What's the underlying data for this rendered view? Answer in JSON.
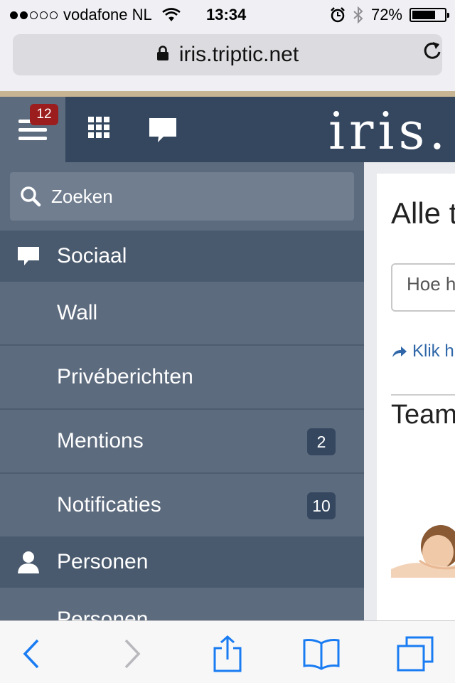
{
  "status_bar": {
    "carrier": "vodafone NL",
    "time": "13:34",
    "battery": "72%",
    "battery_level": 0.72,
    "signal_dots_filled": 2,
    "signal_dots_total": 5
  },
  "browser": {
    "url": "iris.triptic.net"
  },
  "app_header": {
    "menu_badge": "12",
    "logo": "iris."
  },
  "sidebar": {
    "search_placeholder": "Zoeken",
    "sections": [
      {
        "label": "Sociaal",
        "icon": "chat-icon",
        "items": [
          {
            "label": "Wall",
            "count": ""
          },
          {
            "label": "Privéberichten",
            "count": ""
          },
          {
            "label": "Mentions",
            "count": "2"
          },
          {
            "label": "Notificaties",
            "count": "10"
          }
        ]
      },
      {
        "label": "Personen",
        "icon": "person-icon",
        "items": [
          {
            "label": "Personen",
            "count": ""
          }
        ]
      }
    ]
  },
  "content": {
    "heading": "Alle t",
    "input_placeholder": "Hoe h",
    "link_text": "Klik h",
    "section_title": "Team"
  },
  "colors": {
    "header_bg": "#34475f",
    "sidebar_bg": "#5d6b7e",
    "section_bg": "#4a5a6e",
    "badge_red": "#9b1d1d",
    "link_blue": "#2e66a8",
    "ios_blue": "#1a7cf2"
  }
}
